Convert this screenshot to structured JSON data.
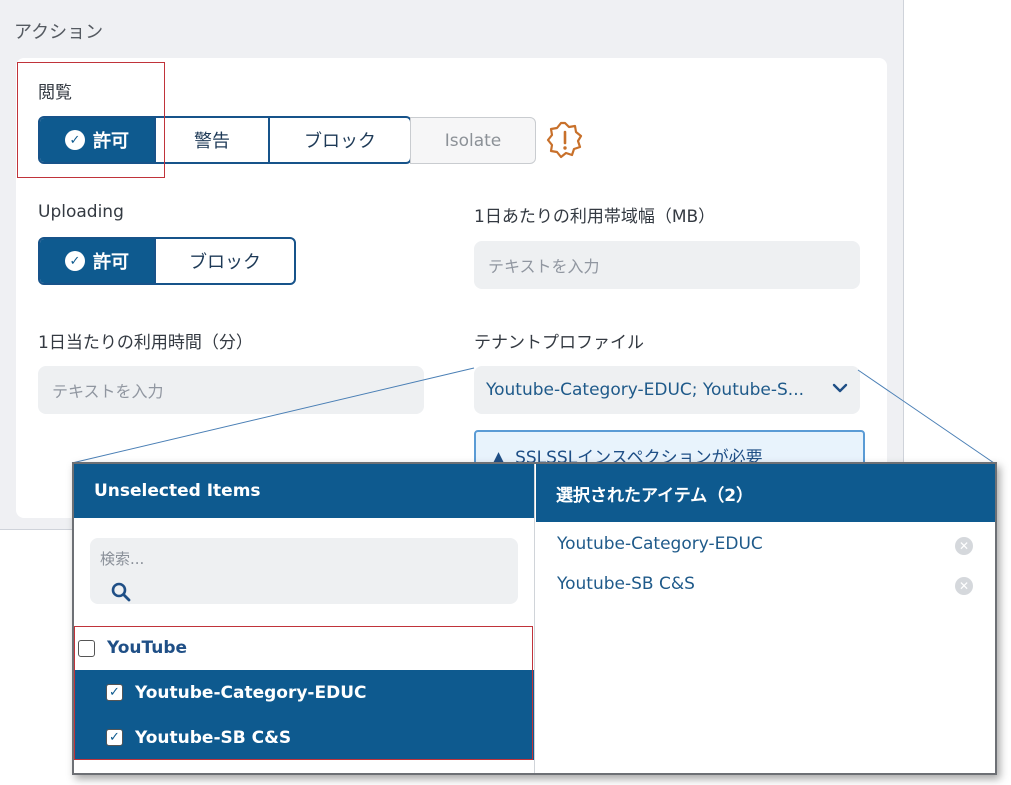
{
  "action_panel": {
    "title": "アクション",
    "browse": {
      "label": "閲覧",
      "options": [
        "許可",
        "警告",
        "ブロック",
        "Isolate"
      ],
      "selected": "許可",
      "warning_icon": "alert-octagon-icon"
    },
    "uploading": {
      "label": "Uploading",
      "options": [
        "許可",
        "ブロック"
      ],
      "selected": "許可"
    },
    "daily_bandwidth": {
      "label": "1日あたりの利用帯域幅（MB）",
      "placeholder": "テキストを入力"
    },
    "daily_time": {
      "label": "1日当たりの利用時間（分）",
      "placeholder": "テキストを入力"
    },
    "tenant_profile": {
      "label": "テナントプロファイル",
      "value": "Youtube-Category-EDUC; Youtube-S..."
    },
    "ssl_notice": "SSLSSLインスペクションが必要"
  },
  "popup": {
    "unselected": {
      "header": "Unselected Items",
      "search_placeholder": "検索...",
      "group": {
        "label": "YouTube",
        "checked": false
      },
      "items": [
        {
          "label": "Youtube-Category-EDUC",
          "checked": true
        },
        {
          "label": "Youtube-SB C&S",
          "checked": true
        }
      ]
    },
    "selected": {
      "header": "選択されたアイテム（2）",
      "items": [
        "Youtube-Category-EDUC",
        "Youtube-SB C&S"
      ]
    }
  },
  "colors": {
    "primary": "#0e5a8f",
    "highlight_outline": "#c0333a",
    "warning": "#c8702a"
  }
}
